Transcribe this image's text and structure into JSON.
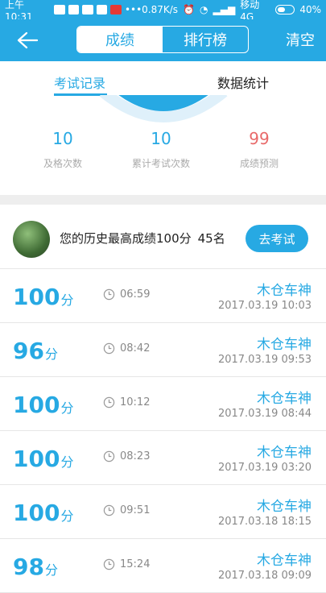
{
  "status": {
    "left_time": "上午10:31",
    "net_speed": "0.87K/s",
    "carrier": "移动4G",
    "battery": "40%"
  },
  "header": {
    "segments": [
      "成绩",
      "排行榜"
    ],
    "clear_label": "清空"
  },
  "subtabs": {
    "record": "考试记录",
    "stats": "数据统计"
  },
  "stats": [
    {
      "value": "10",
      "label": "及格次数"
    },
    {
      "value": "10",
      "label": "累计考试次数"
    },
    {
      "value": "99",
      "label": "成绩预测"
    }
  ],
  "best": {
    "text": "您的历史最高成绩100分",
    "rank": "45名",
    "button": "去考试"
  },
  "records": [
    {
      "score": "100",
      "unit": "分",
      "duration": "06:59",
      "user": "木仓车神",
      "time": "2017.03.19 10:03"
    },
    {
      "score": "96",
      "unit": "分",
      "duration": "08:42",
      "user": "木仓车神",
      "time": "2017.03.19 09:53"
    },
    {
      "score": "100",
      "unit": "分",
      "duration": "10:12",
      "user": "木仓车神",
      "time": "2017.03.19 08:44"
    },
    {
      "score": "100",
      "unit": "分",
      "duration": "08:23",
      "user": "木仓车神",
      "time": "2017.03.19 03:20"
    },
    {
      "score": "100",
      "unit": "分",
      "duration": "09:51",
      "user": "木仓车神",
      "time": "2017.03.18 18:15"
    },
    {
      "score": "98",
      "unit": "分",
      "duration": "15:24",
      "user": "木仓车神",
      "time": "2017.03.18 09:09"
    }
  ],
  "colors": {
    "accent": "#27a9e3",
    "prediction": "#e86a6a"
  }
}
